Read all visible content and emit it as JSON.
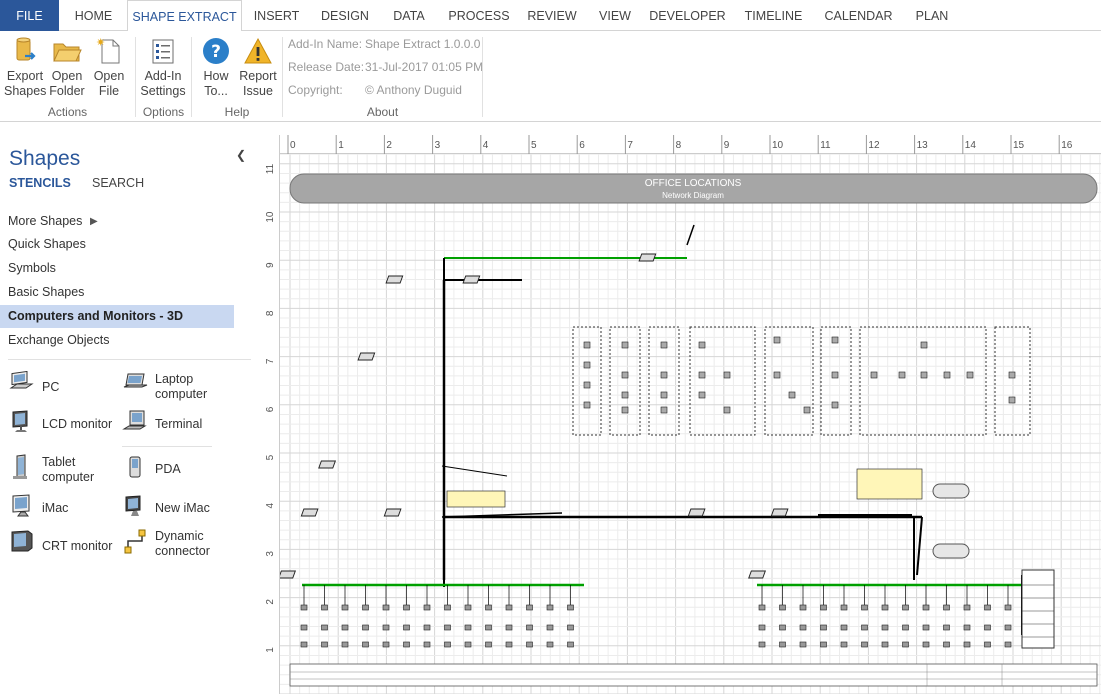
{
  "tabs": [
    {
      "label": "FILE"
    },
    {
      "label": "HOME"
    },
    {
      "label": "SHAPE EXTRACT"
    },
    {
      "label": "INSERT"
    },
    {
      "label": "DESIGN"
    },
    {
      "label": "DATA"
    },
    {
      "label": "PROCESS"
    },
    {
      "label": "REVIEW"
    },
    {
      "label": "VIEW"
    },
    {
      "label": "DEVELOPER"
    },
    {
      "label": "TIMELINE"
    },
    {
      "label": "CALENDAR"
    },
    {
      "label": "PLAN"
    }
  ],
  "ribbon": {
    "buttons": [
      {
        "label1": "Export",
        "label2": "Shapes",
        "icon": "export-shapes-icon"
      },
      {
        "label1": "Open",
        "label2": "Folder",
        "icon": "open-folder-icon"
      },
      {
        "label1": "Open",
        "label2": "File",
        "icon": "open-file-icon"
      },
      {
        "label1": "Add-In",
        "label2": "Settings",
        "icon": "settings-icon"
      },
      {
        "label1": "How",
        "label2": "To...",
        "icon": "help-icon"
      },
      {
        "label1": "Report",
        "label2": "Issue",
        "icon": "warning-icon"
      }
    ],
    "groups": {
      "actions": "Actions",
      "options": "Options",
      "help": "Help",
      "about": "About"
    },
    "about": {
      "name_label": "Add-In Name:",
      "name_value": "Shape Extract 1.0.0.0",
      "release_label": "Release Date:",
      "release_value": "31-Jul-2017 01:05 PM",
      "copyright_label": "Copyright:",
      "copyright_value": "© Anthony Duguid"
    }
  },
  "shapes_pane": {
    "title": "Shapes",
    "collapse_icon": "chevron-left-icon",
    "tab_stencils": "STENCILS",
    "tab_search": "SEARCH",
    "menu": [
      {
        "label": "More Shapes"
      },
      {
        "label": "Quick Shapes"
      },
      {
        "label": "Symbols"
      },
      {
        "label": "Basic Shapes"
      },
      {
        "label": "Computers and Monitors - 3D"
      },
      {
        "label": "Exchange Objects"
      }
    ],
    "shapes": [
      {
        "label": "PC"
      },
      {
        "label": "Laptop computer"
      },
      {
        "label": "LCD monitor"
      },
      {
        "label": "Terminal"
      },
      {
        "label": "Tablet computer"
      },
      {
        "label": "PDA"
      },
      {
        "label": "iMac"
      },
      {
        "label": "New iMac"
      },
      {
        "label": "CRT monitor"
      },
      {
        "label": "Dynamic connector"
      }
    ]
  },
  "ruler": {
    "h": [
      "0",
      "1",
      "2",
      "3",
      "4",
      "5",
      "6",
      "7",
      "8",
      "9",
      "10",
      "11",
      "12",
      "13",
      "14",
      "15",
      "16"
    ],
    "v": [
      "11",
      "10",
      "9",
      "8",
      "7",
      "6",
      "5",
      "4",
      "3",
      "2",
      "1"
    ]
  },
  "diagram": {
    "title": "OFFICE LOCATIONS",
    "subtitle": "Network Diagram",
    "colors": {
      "accent": "#2b579a",
      "title_bar": "#a6a6a6",
      "link": "#00a000",
      "selected": "#c9d8f1"
    }
  }
}
